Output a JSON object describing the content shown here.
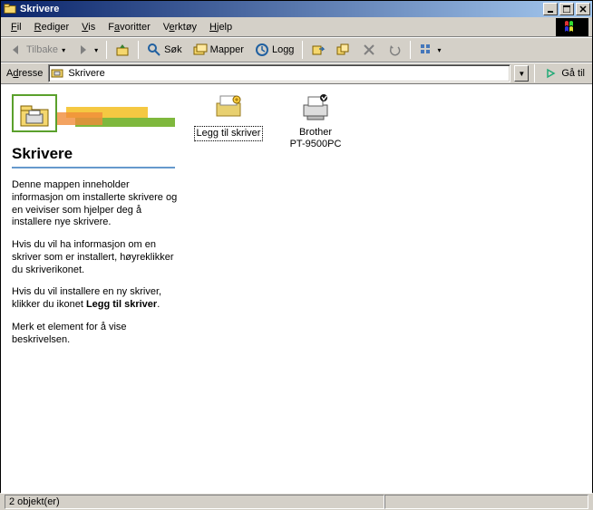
{
  "window": {
    "title": "Skrivere"
  },
  "menu": {
    "fil": "Fil",
    "rediger": "Rediger",
    "vis": "Vis",
    "favoritter": "Favoritter",
    "verktoy": "Verktøy",
    "hjelp": "Hjelp"
  },
  "toolbar": {
    "back": "Tilbake",
    "search": "Søk",
    "folders": "Mapper",
    "history": "Logg"
  },
  "addressbar": {
    "label": "Adresse",
    "value": "Skrivere",
    "go": "Gå til"
  },
  "leftpane": {
    "title": "Skrivere",
    "para1": "Denne mappen inneholder informasjon om installerte skrivere og en veiviser som hjelper deg å installere nye skrivere.",
    "para2": "Hvis du vil ha informasjon om en skriver som er installert, høyreklikker du skriverikonet.",
    "para3a": "Hvis du vil installere en ny skriver, klikker du ikonet ",
    "para3b": "Legg til skriver",
    "para3c": ".",
    "para4": "Merk et element for å vise beskrivelsen."
  },
  "icons": {
    "add_printer": "Legg til skriver",
    "brother_line1": "Brother",
    "brother_line2": "PT-9500PC"
  },
  "statusbar": {
    "text": "2 objekt(er)"
  },
  "colors": {
    "title_start": "#0a246a",
    "title_end": "#a6caf0",
    "accent_blue": "#6699cc"
  }
}
